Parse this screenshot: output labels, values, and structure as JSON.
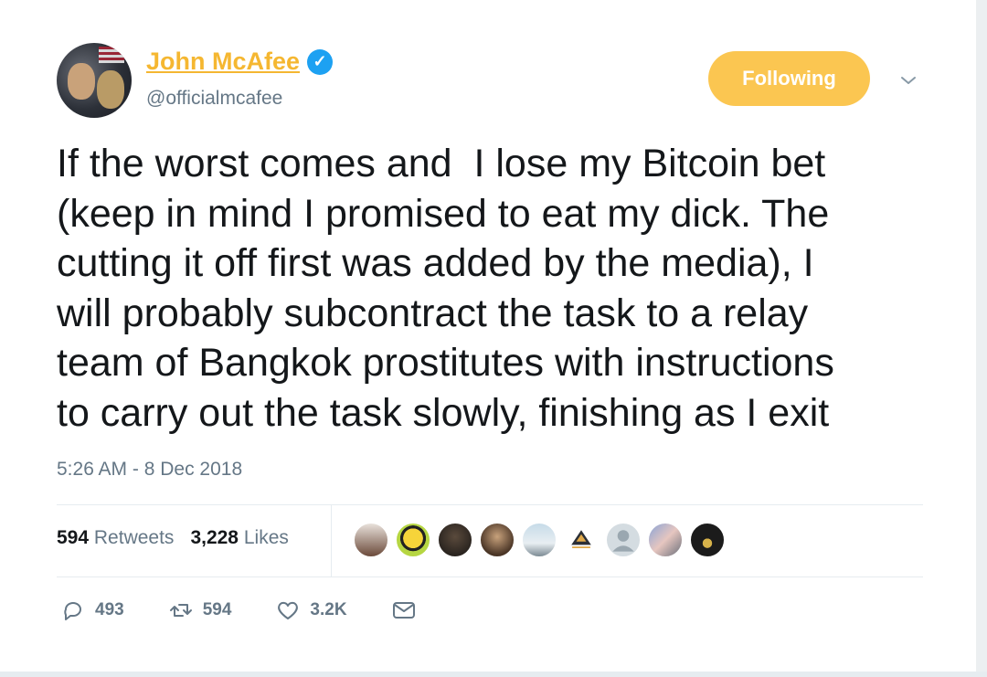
{
  "author": {
    "name": "John McAfee",
    "handle": "@officialmcafee",
    "verified_icon": "verified-badge-icon"
  },
  "header": {
    "follow_label": "Following",
    "menu_icon": "chevron-down-icon"
  },
  "tweet": {
    "text": "If the worst comes and  I lose my Bitcoin bet\n(keep in mind I promised to eat my dick. The\ncutting it off first was added by the media), I\nwill probably subcontract the task to a relay\nteam of Bangkok prostitutes with instructions\nto carry out the task slowly, finishing as I exit",
    "timestamp": "5:26 AM - 8 Dec 2018"
  },
  "stats": {
    "retweets_count": "594",
    "retweets_label": "Retweets",
    "likes_count": "3,228",
    "likes_label": "Likes"
  },
  "actions": {
    "reply_count": "493",
    "retweet_count": "594",
    "like_count": "3.2K"
  },
  "colors": {
    "accent": "#fbc651",
    "name": "#f5b731",
    "verified": "#1da1f2",
    "muted": "#657786"
  }
}
